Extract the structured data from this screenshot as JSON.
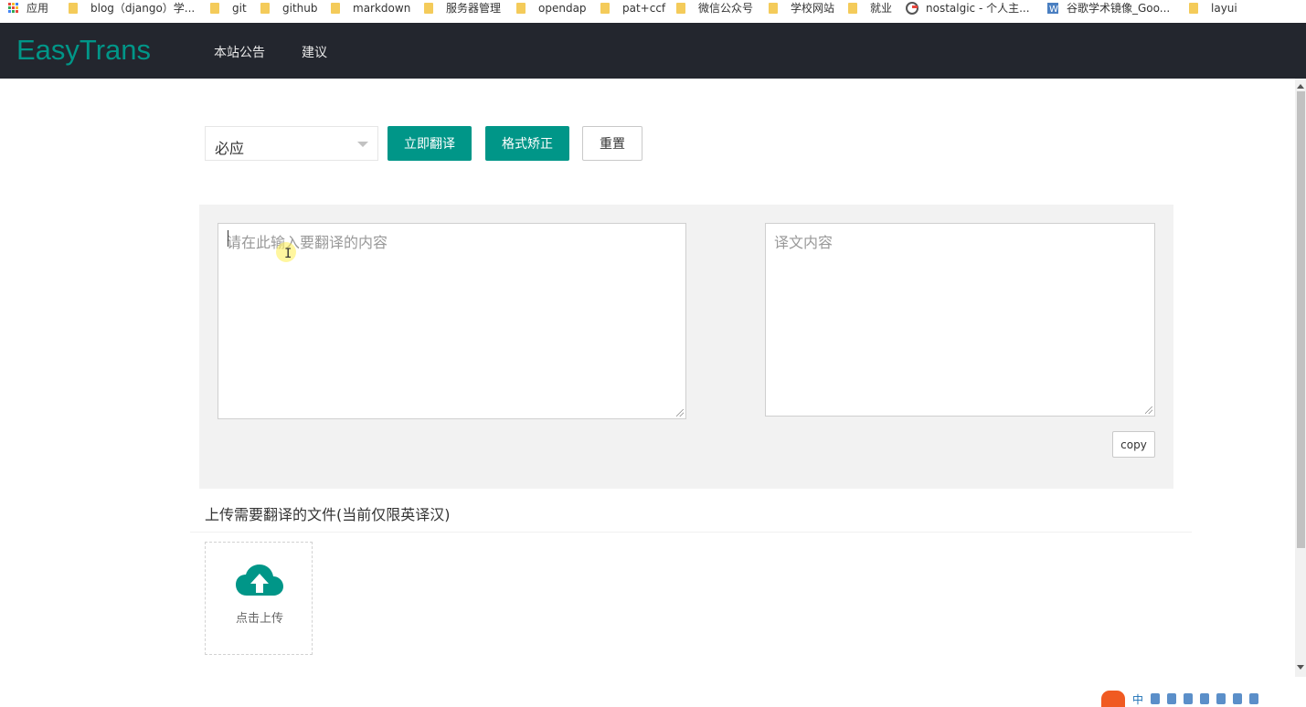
{
  "bookmarks": {
    "apps_label": "应用",
    "items": [
      {
        "label": "blog（django）学...",
        "icon": "folder-icon"
      },
      {
        "label": "git",
        "icon": "folder-icon"
      },
      {
        "label": "github",
        "icon": "folder-icon"
      },
      {
        "label": "markdown",
        "icon": "folder-icon"
      },
      {
        "label": "服务器管理",
        "icon": "folder-icon"
      },
      {
        "label": "opendap",
        "icon": "folder-icon"
      },
      {
        "label": "pat+ccf",
        "icon": "folder-icon"
      },
      {
        "label": "微信公众号",
        "icon": "folder-icon"
      },
      {
        "label": "学校网站",
        "icon": "folder-icon"
      },
      {
        "label": "就业",
        "icon": "folder-icon"
      },
      {
        "label": "nostalgic - 个人主...",
        "icon": "site-icon"
      },
      {
        "label": "谷歌学术镜像_Goo...",
        "icon": "site-icon"
      },
      {
        "label": "layui",
        "icon": "folder-icon"
      }
    ]
  },
  "navbar": {
    "brand": "EasyTrans",
    "items": [
      "本站公告",
      "建议"
    ]
  },
  "toolbar": {
    "engine_selected": "必应",
    "translate_label": "立即翻译",
    "format_label": "格式矫正",
    "reset_label": "重置"
  },
  "translator": {
    "source_placeholder": "请在此输入要翻译的内容",
    "target_placeholder": "译文内容",
    "copy_label": "copy"
  },
  "upload": {
    "header": "上传需要翻译的文件(当前仅限英译汉)",
    "button_label": "点击上传"
  },
  "tray": {
    "ime_label": "中"
  },
  "colors": {
    "brand": "#009688",
    "navbar_bg": "#23262e",
    "panel_bg": "#f2f2f2"
  }
}
